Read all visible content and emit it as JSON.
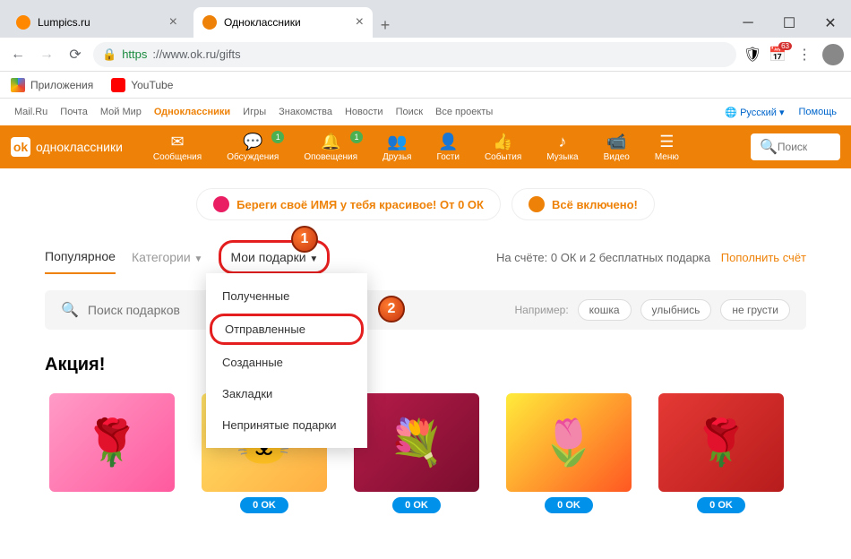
{
  "window": {
    "tabs": [
      {
        "title": "Lumpics.ru",
        "favicon_color": "#ff8800"
      },
      {
        "title": "Одноклассники",
        "favicon_color": "#ee8208"
      }
    ],
    "url_https": "https",
    "url_rest": "://www.ok.ru/gifts",
    "bookmarks": [
      {
        "label": "Приложения"
      },
      {
        "label": "YouTube"
      }
    ],
    "ext_badge": "63"
  },
  "toplinks": {
    "items": [
      "Mail.Ru",
      "Почта",
      "Мой Мир",
      "Одноклассники",
      "Игры",
      "Знакомства",
      "Новости",
      "Поиск",
      "Все проекты"
    ],
    "active_index": 3,
    "language": "Русский",
    "help": "Помощь"
  },
  "navbar": {
    "brand": "одноклассники",
    "items": [
      {
        "icon": "✉",
        "label": "Сообщения",
        "badge": ""
      },
      {
        "icon": "💬",
        "label": "Обсуждения",
        "badge": "1"
      },
      {
        "icon": "🔔",
        "label": "Оповещения",
        "badge": "1"
      },
      {
        "icon": "👥",
        "label": "Друзья",
        "badge": ""
      },
      {
        "icon": "👤",
        "label": "Гости",
        "badge": ""
      },
      {
        "icon": "👍",
        "label": "События",
        "badge": ""
      },
      {
        "icon": "♪",
        "label": "Музыка",
        "badge": ""
      },
      {
        "icon": "📹",
        "label": "Видео",
        "badge": ""
      },
      {
        "icon": "☰",
        "label": "Меню",
        "badge": ""
      }
    ],
    "search_placeholder": "Поиск"
  },
  "promos": [
    "Береги своё ИМЯ у тебя красивое! От 0 ОК",
    "Всё включено!"
  ],
  "tabs": {
    "popular": "Популярное",
    "categories": "Категории",
    "my_gifts": "Мои подарки",
    "account_text": "На счёте: 0 ОК и 2 бесплатных подарка",
    "topup": "Пополнить счёт"
  },
  "markers": {
    "one": "1",
    "two": "2"
  },
  "search": {
    "placeholder": "Поиск подарков",
    "example_label": "Например:",
    "chips": [
      "кошка",
      "улыбнись",
      "не грусти"
    ]
  },
  "dropdown": {
    "items": [
      "Полученные",
      "Отправленные",
      "Созданные",
      "Закладки",
      "Непринятые подарки"
    ],
    "highlighted_index": 1
  },
  "section": {
    "title": "Акция!"
  },
  "gifts": [
    {
      "bg": "linear-gradient(135deg,#ff9bc6,#ff5a9e)",
      "emoji": "🌹",
      "price": ""
    },
    {
      "bg": "linear-gradient(135deg,#ffe066,#ffae42)",
      "emoji": "🐱",
      "price": "0 OK"
    },
    {
      "bg": "linear-gradient(135deg,#b71c4a,#7a0d2e)",
      "emoji": "💐",
      "price": "0 OK"
    },
    {
      "bg": "linear-gradient(135deg,#ffeb3b,#ff5722)",
      "emoji": "🌷",
      "price": "0 OK"
    },
    {
      "bg": "linear-gradient(135deg,#e53935,#b71c1c)",
      "emoji": "🌹",
      "price": "0 OK"
    }
  ]
}
